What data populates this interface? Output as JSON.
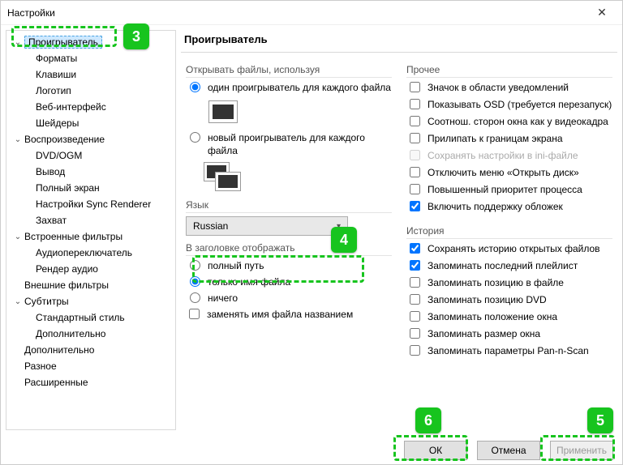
{
  "window": {
    "title": "Настройки"
  },
  "tree": {
    "player": "Проигрыватель",
    "formats": "Форматы",
    "keys": "Клавиши",
    "logo": "Логотип",
    "web": "Веб-интерфейс",
    "shaders": "Шейдеры",
    "playback": "Воспроизведение",
    "dvd": "DVD/OGM",
    "output": "Вывод",
    "fullscreen": "Полный экран",
    "sync": "Настройки Sync Renderer",
    "capture": "Захват",
    "builtin": "Встроенные фильтры",
    "audioswitch": "Аудиопереключатель",
    "audiorender": "Рендер аудио",
    "external": "Внешние фильтры",
    "subtitles": "Субтитры",
    "stdstyle": "Стандартный стиль",
    "advanced_sub": "Дополнительно",
    "advanced": "Дополнительно",
    "misc": "Разное",
    "extended": "Расширенные"
  },
  "panel": {
    "title": "Проигрыватель"
  },
  "open": {
    "group": "Открывать файлы, используя",
    "one": "один проигрыватель для каждого файла",
    "new": "новый проигрыватель для каждого файла"
  },
  "lang": {
    "label": "Язык",
    "value": "Russian"
  },
  "titledisp": {
    "group": "В заголовке отображать",
    "fullpath": "полный путь",
    "nameonly": "только имя файла",
    "nothing": "ничего",
    "replace": "заменять имя файла названием"
  },
  "other": {
    "group": "Прочее",
    "trayicon": "Значок в области уведомлений",
    "osd": "Показывать OSD (требуется перезапуск)",
    "aspect": "Соотнош. сторон окна как у видеокадра",
    "snap": "Прилипать к границам экрана",
    "ini": "Сохранять настройки в ini-файле",
    "disopen": "Отключить меню «Открыть диск»",
    "priority": "Повышенный приоритет процесса",
    "covers": "Включить поддержку обложек"
  },
  "history": {
    "group": "История",
    "savehist": "Сохранять историю открытых файлов",
    "lastpl": "Запоминать последний плейлист",
    "filepos": "Запоминать позицию в файле",
    "dvdpos": "Запоминать позицию DVD",
    "winpos": "Запоминать положение окна",
    "winsize": "Запоминать размер окна",
    "panscan": "Запоминать параметры Pan-n-Scan"
  },
  "buttons": {
    "ok": "ОК",
    "cancel": "Отмена",
    "apply": "Применить"
  },
  "callouts": {
    "c3": "3",
    "c4": "4",
    "c5": "5",
    "c6": "6"
  }
}
